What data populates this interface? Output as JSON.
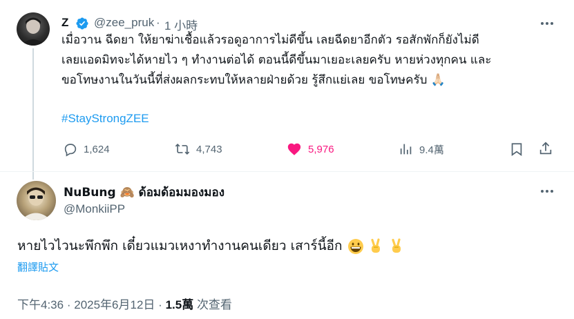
{
  "tweet": {
    "author_name": "Z",
    "author_handle": "@zee_pruk",
    "time_sep": "·",
    "time_ago": "1 小時",
    "text_lines": [
      "เมื่อวาน ฉีดยา ให้ยาฆ่าเชื้อแล้วรอดูอาการไม่ดีขึ้น เลยฉีดยาอีกตัว รอสักพักก็ยังไม่ดี",
      "เลยแอดมิทจะได้หายไว ๆ ทำงานต่อได้ ตอนนี้ดีขึ้นมาเยอะเลยครับ หายห่วงทุกคน และ",
      "ขอโทษงานในวันนี้ที่ส่งผลกระทบให้หลายฝ่ายด้วย รู้สึกแย่เลย ขอโทษครับ 🙏🏻"
    ],
    "hashtag": "#StayStrongZEE",
    "metrics": {
      "replies": "1,624",
      "reposts": "4,743",
      "likes": "5,976",
      "views": "9.4萬"
    },
    "colors": {
      "verified": "#1d9bf0",
      "like": "#f91880",
      "link": "#1d9bf0"
    }
  },
  "reply": {
    "author_name": "NuBung 🙈 ด้อมด้อมมองมอง",
    "author_handle": "@MonkiiPP",
    "text": "หายไวไวนะพึกพึก เดี๋ยวแมวเหงาทำงานคนเดียว เสาร์นี้อีก",
    "emojis": [
      "grinning-face",
      "victory-hand",
      "victory-hand"
    ],
    "translate_label": "翻譯貼文",
    "time": "下午4:36",
    "date": "2025年6月12日",
    "views_count": "1.5萬",
    "views_label": "次查看",
    "sep": "·"
  }
}
